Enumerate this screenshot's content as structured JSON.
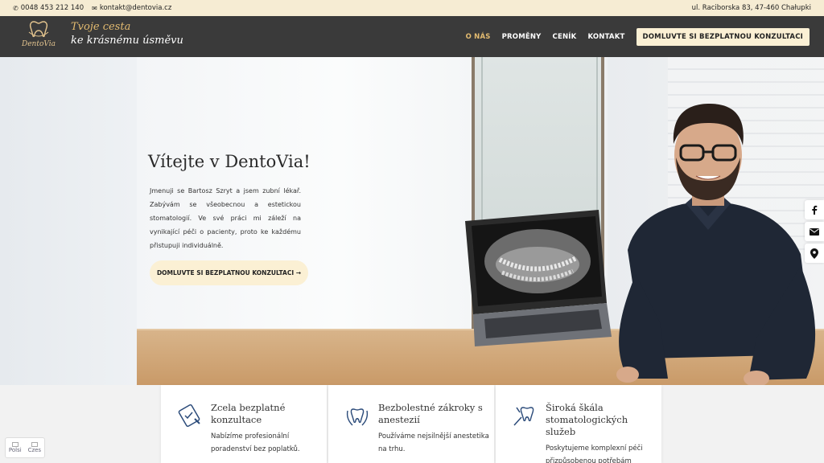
{
  "topbar": {
    "phone": "0048 453 212 140",
    "email": "kontakt@dentovia.cz",
    "address": "ul. Raciborska 83, 47-460 Chałupki"
  },
  "header": {
    "logo_text": "DentoVia",
    "tagline_line1": "Tvoje cesta",
    "tagline_line2": "ke krásnému úsměvu",
    "nav": [
      "O NÁS",
      "PROMĚNY",
      "CENÍK",
      "KONTAKT"
    ],
    "cta": "DOMLUVTE SI BEZPLATNOU KONZULTACI"
  },
  "hero": {
    "title": "Vítejte v DentoVia!",
    "text": "Jmenuji se Bartosz Szryt a jsem zubní lékař. Zabývám se všeobecnou a estetickou stomatologií. Ve své práci mi záleží na vynikající péči o pacienty, proto ke každému přistupuji individuálně.",
    "button": "DOMLUVTE SI BEZPLATNOU KONZULTACI →"
  },
  "social": [
    "facebook-icon",
    "mail-icon",
    "location-icon"
  ],
  "features": [
    {
      "icon": "clipboard-icon",
      "title": "Zcela bezplatné konzultace",
      "desc": "Nabízíme profesionální poradenství bez poplatků."
    },
    {
      "icon": "tooth-laurel-icon",
      "title": "Bezbolestné zákroky s anestezií",
      "desc": "Používáme nejsilnější anestetika na trhu."
    },
    {
      "icon": "dental-tools-icon",
      "title": "Široká škála stomatologických služeb",
      "desc": "Poskytujeme komplexní péči přizpůsobenou potřebám"
    }
  ],
  "language": {
    "pl": "Polsi",
    "cz": "Czes"
  },
  "colors": {
    "accent": "#e3bb70",
    "header_bg": "#3a3a3a",
    "cream": "#fbf0d4"
  }
}
